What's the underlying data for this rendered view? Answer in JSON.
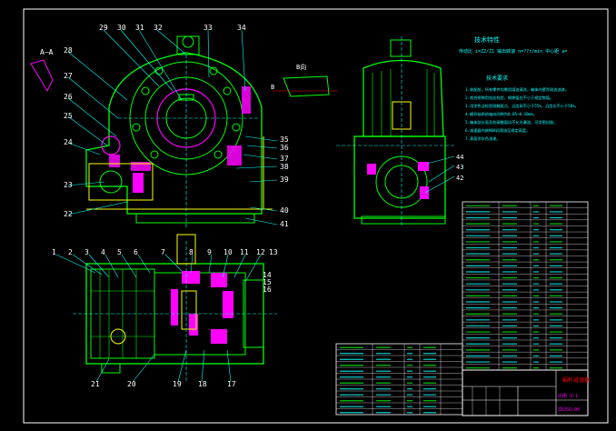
{
  "drawing": {
    "section_label": "A—A",
    "view_b_label": "B向",
    "marker_b": "B",
    "callouts_top": [
      "29",
      "30",
      "31",
      "32",
      "33",
      "34"
    ],
    "callouts_left_top": [
      "28",
      "27",
      "26",
      "25",
      "24",
      "23",
      "22"
    ],
    "callouts_right_top": [
      "35",
      "36",
      "37",
      "38",
      "39",
      "40",
      "41"
    ],
    "callouts_plan_top": [
      "1",
      "2",
      "3",
      "4",
      "5",
      "6",
      "7",
      "8",
      "9",
      "10",
      "11",
      "12",
      "13"
    ],
    "callouts_plan_right": [
      "14",
      "15",
      "16"
    ],
    "callouts_plan_bottom": [
      "21",
      "20",
      "19",
      "18",
      "17"
    ],
    "callouts_side": [
      "44",
      "43",
      "42"
    ],
    "tech_title": "技术特性",
    "tech_line": "传动比 i=Z2/Z1   输出转速 n=??r/min   中心距 a=",
    "notes_title": "技术要求",
    "notes": [
      "1.装配前，所有零件均需用煤油清洗，箱体内壁涂耐油油漆。",
      "2.啮合侧隙用铅丝检验，侧隙值应不小于规定数值。",
      "3.用涂色法检验接触斑点，沿齿高不小于55%，沿齿长不小于50%。",
      "4.蜗杆轴承的轴向间隙为0.05~0.10mm。",
      "5.箱体剖分面及各接触面均不允许漏油，可涂密封胶。",
      "6.减速器内装N68润滑油至规定高度。",
      "7.表面涂灰色油漆。"
    ],
    "title_block": {
      "name": "蜗杆减速器",
      "drawing_no": "ZDJSQ-00",
      "unit": "比例 1:1"
    }
  },
  "colors": {
    "background": "#000000",
    "frame": "#ffffff",
    "outline": "#00ff00",
    "section": "#ff00ff",
    "hidden": "#ffff00",
    "dim": "#00ffff",
    "accent": "#ff0000"
  }
}
